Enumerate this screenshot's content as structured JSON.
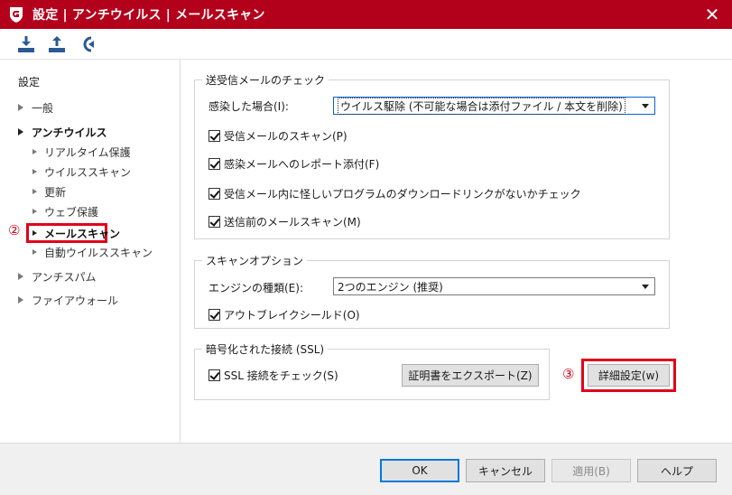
{
  "window": {
    "title": "設定 | アンチウイルス | メールスキャン",
    "close_glyph": "✕",
    "accent_color": "#b3001b"
  },
  "toolbar": {
    "icons": [
      "import-icon",
      "export-icon",
      "reset-icon"
    ]
  },
  "sidebar": {
    "heading": "設定",
    "items": [
      {
        "label": "一般"
      },
      {
        "label": "アンチウイルス"
      },
      {
        "label": "リアルタイム保護"
      },
      {
        "label": "ウイルススキャン"
      },
      {
        "label": "更新"
      },
      {
        "label": "ウェブ保護"
      },
      {
        "label": "メールスキャン"
      },
      {
        "label": "自動ウイルススキャン"
      },
      {
        "label": "アンチスパム"
      },
      {
        "label": "ファイアウォール"
      }
    ]
  },
  "annotations": {
    "marker_2": "②",
    "marker_3": "③",
    "highlight_color": "#e0001a"
  },
  "mail_check": {
    "group_label": "送受信メールのチェック",
    "infected_label": "感染した場合(I):",
    "infected_value": "ウイルス駆除 (不可能な場合は添付ファイル / 本文を削除)",
    "checks": [
      {
        "label": "受信メールのスキャン(P)",
        "checked": true
      },
      {
        "label": "感染メールへのレポート添付(F)",
        "checked": true
      },
      {
        "label": "受信メール内に怪しいプログラムのダウンロードリンクがないかチェック",
        "checked": true
      },
      {
        "label": "送信前のメールスキャン(M)",
        "checked": true
      }
    ]
  },
  "scan_options": {
    "group_label": "スキャンオプション",
    "engine_label": "エンジンの種類(E):",
    "engine_value": "2つのエンジン (推奨)",
    "outbreak_label": "アウトブレイクシールド(O)",
    "outbreak_checked": true
  },
  "ssl": {
    "group_label": "暗号化された接続 (SSL)",
    "check_label": "SSL 接続をチェック(S)",
    "checked": true,
    "export_button": "証明書をエクスポート(Z)"
  },
  "advanced_button": "詳細設定(w)",
  "footer": {
    "ok": "OK",
    "cancel": "キャンセル",
    "apply": "適用(B)",
    "help": "ヘルプ"
  }
}
